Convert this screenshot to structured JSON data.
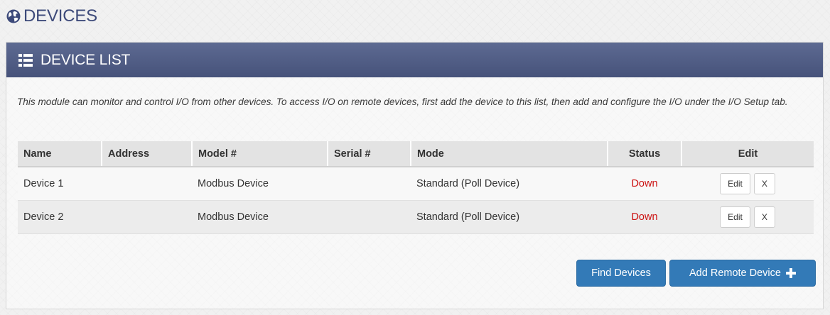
{
  "page": {
    "title": "DEVICES"
  },
  "panel": {
    "title": "DEVICE LIST",
    "description": "This module can monitor and control I/O from other devices. To access I/O on remote devices, first add the device to this list, then add and configure the I/O under the I/O Setup tab."
  },
  "table": {
    "headers": [
      "Name",
      "Address",
      "Model #",
      "Serial #",
      "Mode",
      "Status",
      "Edit"
    ],
    "rows": [
      {
        "name": "Device 1",
        "address": "",
        "model": "Modbus Device",
        "serial": "",
        "mode": "Standard (Poll Device)",
        "status": "Down",
        "edit_label": "Edit",
        "delete_label": "X"
      },
      {
        "name": "Device 2",
        "address": "",
        "model": "Modbus Device",
        "serial": "",
        "mode": "Standard (Poll Device)",
        "status": "Down",
        "edit_label": "Edit",
        "delete_label": "X"
      }
    ]
  },
  "actions": {
    "find_devices_label": "Find Devices",
    "add_remote_device_label": "Add Remote Device"
  },
  "icons": {
    "header": "globe-icon",
    "panel": "list-icon",
    "add": "plus-icon"
  },
  "colors": {
    "title": "#3d4a7a",
    "panel_heading": "#4f5b84",
    "status_down": "#cc1111",
    "primary_button": "#337ab7"
  }
}
